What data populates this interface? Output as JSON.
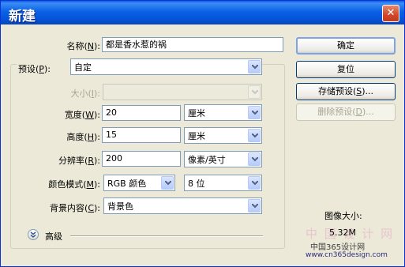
{
  "window": {
    "title": "新建",
    "close_glyph": "✕",
    "close_icon": "close-icon"
  },
  "form": {
    "name": {
      "label": "名称(",
      "hotkey": "N",
      "suffix": "):",
      "value": "都是香水惹的祸"
    },
    "preset": {
      "label": "预设(",
      "hotkey": "P",
      "suffix": "):",
      "value": "自定"
    },
    "size": {
      "label": "大小(",
      "hotkey": "I",
      "suffix": "):",
      "value": "",
      "disabled": true
    },
    "width": {
      "label": "宽度(",
      "hotkey": "W",
      "suffix": "):",
      "value": "20",
      "unit": "厘米"
    },
    "height": {
      "label": "高度(",
      "hotkey": "H",
      "suffix": "):",
      "value": "15",
      "unit": "厘米"
    },
    "resolution": {
      "label": "分辨率(",
      "hotkey": "R",
      "suffix": "):",
      "value": "200",
      "unit": "像素/英寸"
    },
    "color_mode": {
      "label": "颜色模式(",
      "hotkey": "M",
      "suffix": "):",
      "value": "RGB 颜色",
      "bits": "8 位"
    },
    "background": {
      "label": "背景内容(",
      "hotkey": "C",
      "suffix": "):",
      "value": "背景色"
    },
    "advanced": {
      "label": "高级"
    }
  },
  "buttons": {
    "ok": "确定",
    "reset": "复位",
    "save_preset": {
      "text": "存储预设(",
      "hotkey": "S",
      "suffix": ")..."
    },
    "delete_preset": {
      "text": "删除预设(",
      "hotkey": "D",
      "suffix": ")...",
      "disabled": true
    }
  },
  "image_size": {
    "label": "图像大小:",
    "value": "5.32M"
  },
  "watermark": {
    "line1": "中国365设计网",
    "line2": "www.cn365design.com",
    "bg_text": "中 国 设 计 网"
  },
  "colors": {
    "title_bar": "#0a5ce0",
    "dialog_bg": "#ece9d8",
    "field_border": "#7f9db9",
    "close_button": "#d1462a"
  }
}
